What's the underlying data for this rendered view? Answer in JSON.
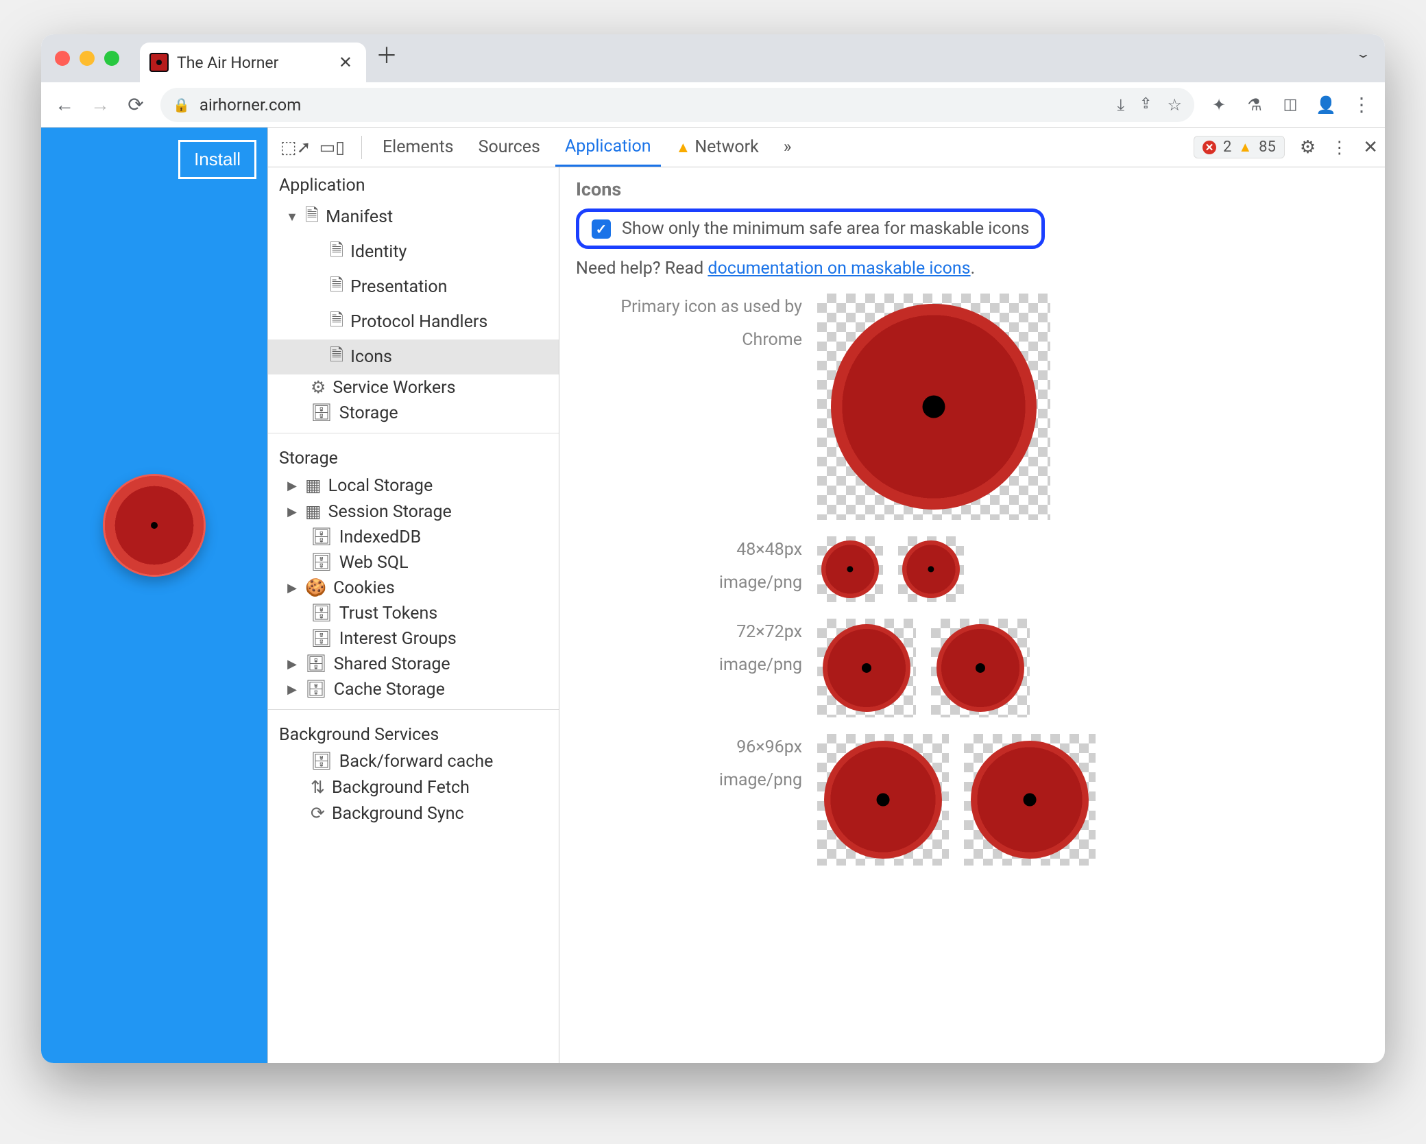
{
  "tab": {
    "title": "The Air Horner"
  },
  "url": "airhorner.com",
  "page": {
    "install": "Install"
  },
  "devtools": {
    "tabs": {
      "elements": "Elements",
      "sources": "Sources",
      "application": "Application",
      "network": "Network"
    },
    "errors": "2",
    "warnings": "85"
  },
  "sidebar": {
    "section_application": "Application",
    "manifest": "Manifest",
    "manifest_children": {
      "identity": "Identity",
      "presentation": "Presentation",
      "protocol_handlers": "Protocol Handlers",
      "icons": "Icons"
    },
    "service_workers": "Service Workers",
    "storage": "Storage",
    "section_storage": "Storage",
    "storage_items": {
      "local_storage": "Local Storage",
      "session_storage": "Session Storage",
      "indexeddb": "IndexedDB",
      "websql": "Web SQL",
      "cookies": "Cookies",
      "trust_tokens": "Trust Tokens",
      "interest_groups": "Interest Groups",
      "shared_storage": "Shared Storage",
      "cache_storage": "Cache Storage"
    },
    "section_background": "Background Services",
    "bg_items": {
      "bfcache": "Back/forward cache",
      "bgfetch": "Background Fetch",
      "bgsync": "Background Sync"
    }
  },
  "panel": {
    "title": "Icons",
    "checkbox_label": "Show only the minimum safe area for maskable icons",
    "help_prefix": "Need help? Read ",
    "help_link": "documentation on maskable icons",
    "primary_label_line1": "Primary icon as used by",
    "primary_label_line2": "Chrome",
    "rows": {
      "r48": {
        "size": "48×48px",
        "type": "image/png"
      },
      "r72": {
        "size": "72×72px",
        "type": "image/png"
      },
      "r96": {
        "size": "96×96px",
        "type": "image/png"
      }
    }
  }
}
